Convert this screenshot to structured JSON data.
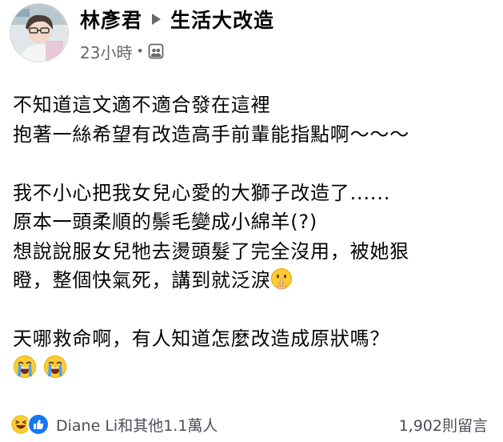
{
  "post": {
    "author": "林彥君",
    "group": "生活大改造",
    "time": "23小時",
    "separator": "•",
    "audience_icon": "group-icon"
  },
  "body": {
    "paragraphs": [
      [
        "不知道這文適不適合發在這裡",
        "抱著一絲希望有改造高手前輩能指點啊～～～"
      ],
      [
        "我不小心把我女兒心愛的大獅子改造了......",
        "原本一頭柔順的鬃毛變成小綿羊(?)",
        "想說說服女兒牠去燙頭髮了完全沒用，被她狠",
        "瞪，整個快氣死，講到就泛淚"
      ],
      [
        "天哪救命啊，有人知道怎麼改造成原狀嗎？"
      ]
    ],
    "emojis": {
      "shush": "shushing-face-icon",
      "crying": [
        "loudly-crying-face-icon",
        "loudly-crying-face-icon"
      ]
    }
  },
  "footer": {
    "reaction_icons": [
      "haha-reaction-icon",
      "like-reaction-icon"
    ],
    "reaction_text": "Diane Li和其他1.1萬人",
    "comments": "1,902則留言"
  },
  "colors": {
    "text": "#050505",
    "secondary": "#65676b",
    "like_blue": "#1877f2",
    "emoji_yellow": "#ffcc33"
  }
}
